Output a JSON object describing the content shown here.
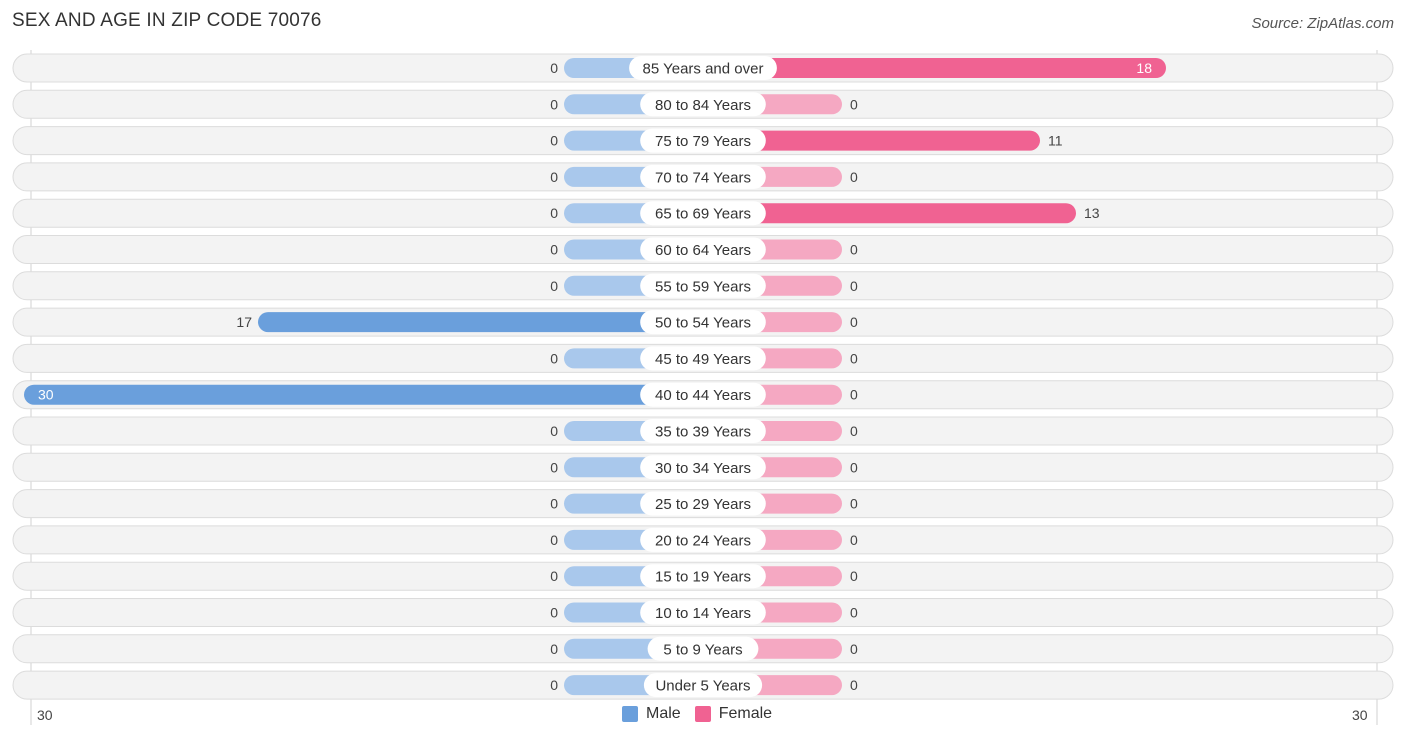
{
  "chart_data": {
    "type": "bar",
    "orientation": "horizontal-diverging",
    "title": "SEX AND AGE IN ZIP CODE 70076",
    "source": "Source: ZipAtlas.com",
    "categories": [
      "85 Years and over",
      "80 to 84 Years",
      "75 to 79 Years",
      "70 to 74 Years",
      "65 to 69 Years",
      "60 to 64 Years",
      "55 to 59 Years",
      "50 to 54 Years",
      "45 to 49 Years",
      "40 to 44 Years",
      "35 to 39 Years",
      "30 to 34 Years",
      "25 to 29 Years",
      "20 to 24 Years",
      "15 to 19 Years",
      "10 to 14 Years",
      "5 to 9 Years",
      "Under 5 Years"
    ],
    "series": [
      {
        "name": "Male",
        "color": "#6a9fdc",
        "values": [
          0,
          0,
          0,
          0,
          0,
          0,
          0,
          17,
          0,
          30,
          0,
          0,
          0,
          0,
          0,
          0,
          0,
          0
        ]
      },
      {
        "name": "Female",
        "color": "#f06292",
        "values": [
          18,
          0,
          11,
          0,
          13,
          0,
          0,
          0,
          0,
          0,
          0,
          0,
          0,
          0,
          0,
          0,
          0,
          0
        ]
      }
    ],
    "xlim": [
      30,
      30
    ],
    "axis_left_label": "30",
    "axis_right_label": "30",
    "legend": {
      "position": "bottom-center",
      "entries": [
        "Male",
        "Female"
      ]
    },
    "colors": {
      "male_strong": "#6a9fdc",
      "male_light": "#a9c8ec",
      "female_strong": "#f06292",
      "female_light": "#f5a8c2",
      "row_bg": "#f3f3f3"
    }
  }
}
